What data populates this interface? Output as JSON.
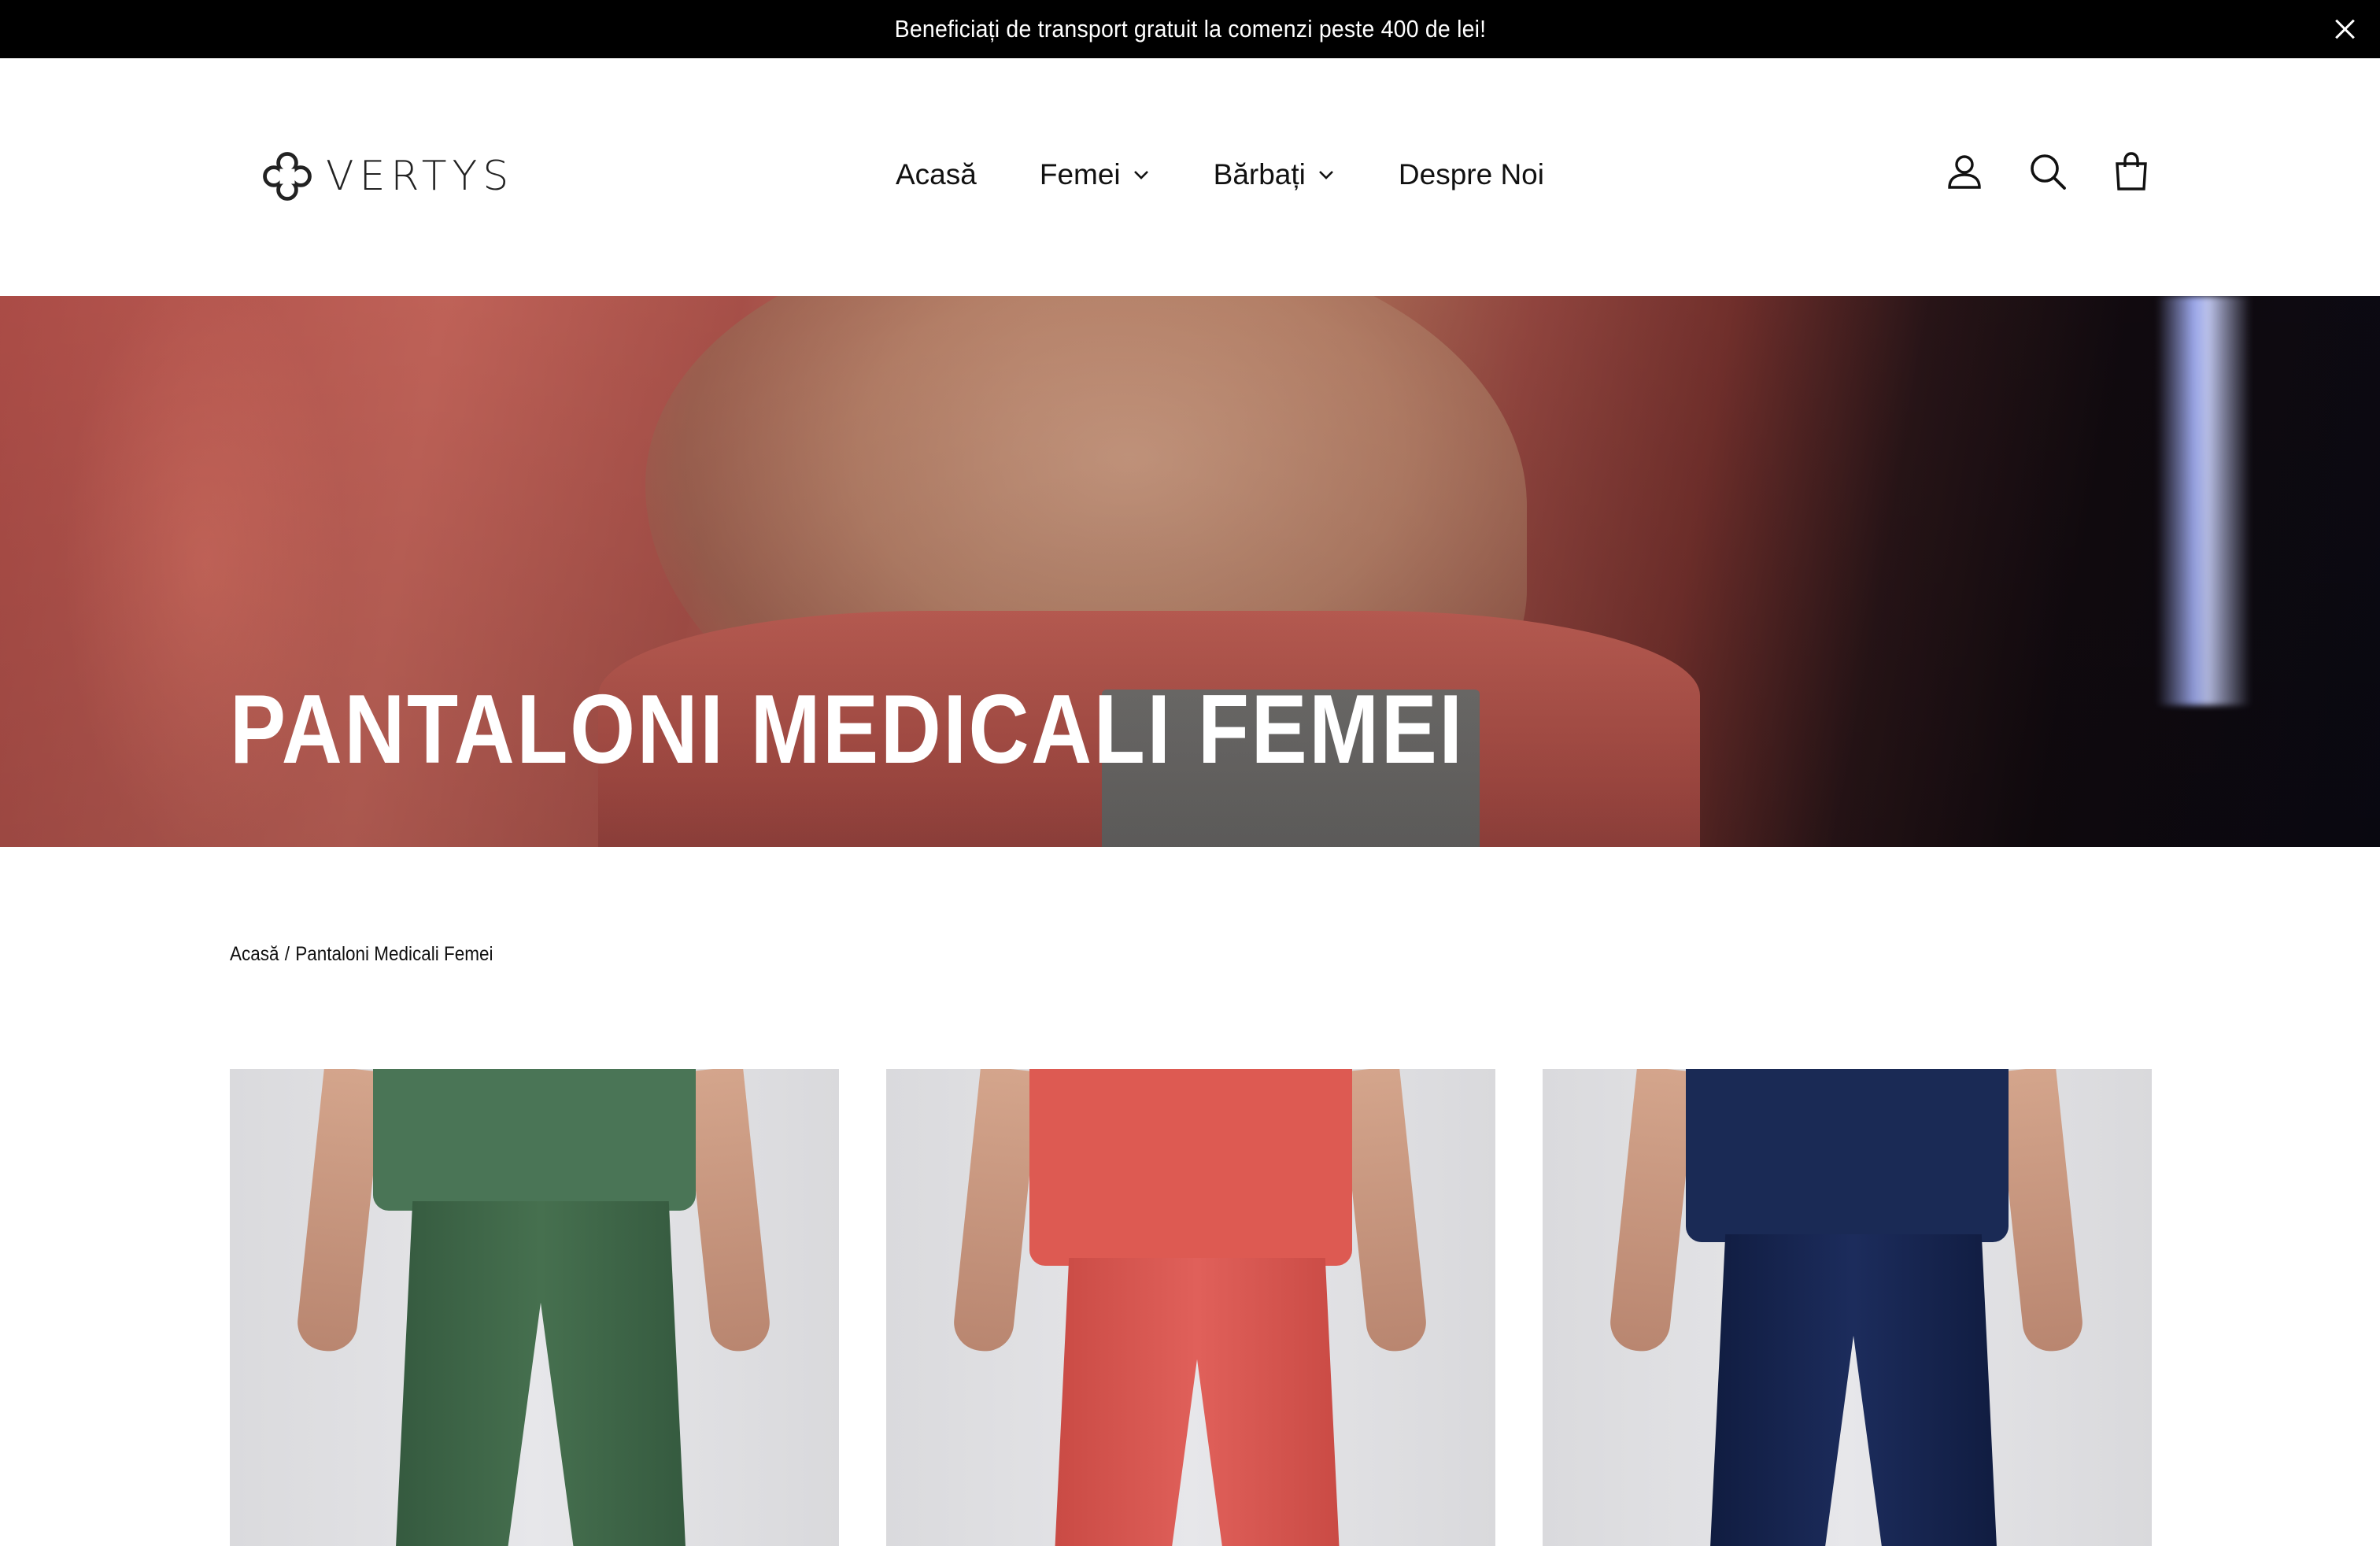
{
  "announcement": {
    "text": "Beneficiați de transport gratuit la comenzi peste 400 de lei!"
  },
  "brand": {
    "name": "VERTYS"
  },
  "nav": {
    "items": [
      {
        "label": "Acasă",
        "has_dropdown": false
      },
      {
        "label": "Femei",
        "has_dropdown": true
      },
      {
        "label": "Bărbați",
        "has_dropdown": true
      },
      {
        "label": "Despre Noi",
        "has_dropdown": false
      }
    ]
  },
  "header_icons": [
    "account-icon",
    "search-icon",
    "cart-icon"
  ],
  "hero": {
    "title": "PANTALONI MEDICALI FEMEI"
  },
  "breadcrumb": {
    "home": "Acasă",
    "separator": "/",
    "current": "Pantaloni Medicali Femei"
  },
  "products": [
    {
      "color": "#3f6a4a",
      "top_color": "#4a7556"
    },
    {
      "color": "#d9574f",
      "top_color": "#dd5a52"
    },
    {
      "color": "#152349",
      "top_color": "#1a2a55"
    }
  ],
  "colors": {
    "announcement_bg": "#000000",
    "text": "#111111",
    "background": "#ffffff"
  }
}
